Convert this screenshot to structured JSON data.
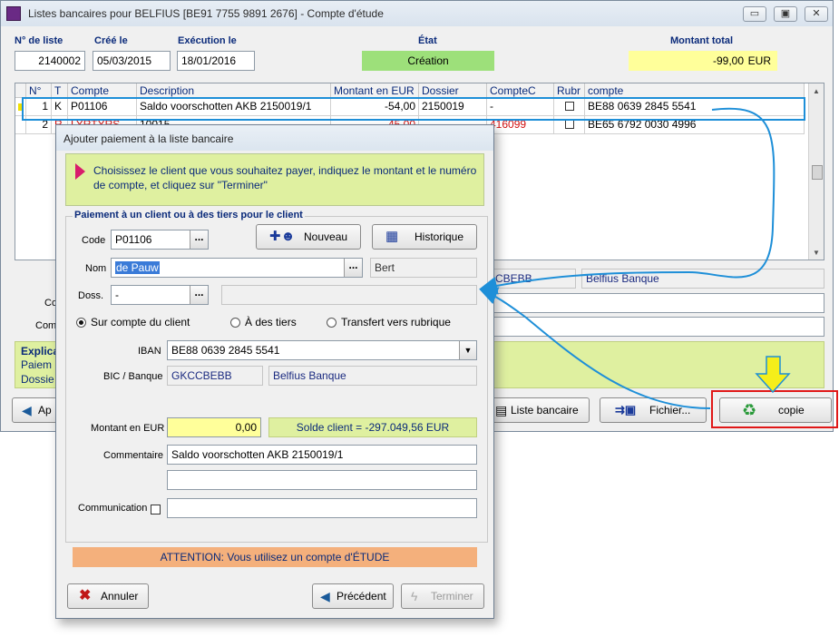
{
  "main_window": {
    "title": "Listes bancaires pour BELFIUS [BE91 7755 9891 2676] - Compte d'étude",
    "minimize": "▭",
    "restore": "▣",
    "close": "✕"
  },
  "header": {
    "num_label": "N° de liste",
    "num_value": "2140002",
    "created_label": "Créé le",
    "created_value": "05/03/2015",
    "exec_label": "Exécution le",
    "exec_value": "18/01/2016",
    "state_label": "État",
    "state_value": "Création",
    "total_label": "Montant total",
    "total_value": "-99,00",
    "total_currency": "EUR"
  },
  "grid": {
    "columns": [
      "N°",
      "T",
      "Compte",
      "Description",
      "Montant en EUR",
      "Dossier",
      "CompteC",
      "Rubr",
      "compte"
    ],
    "rows": [
      {
        "n": "1",
        "t": "K",
        "compte": "P01106",
        "description": "Saldo voorschotten AKB 2150019/1",
        "montant": "-54,00",
        "dossier": "2150019",
        "comptec": "-",
        "iban": "BE88 0639 2845 5541"
      },
      {
        "n": "2",
        "t": "R",
        "compte": "LYRTYRS",
        "description": "10015",
        "montant": "-45,00",
        "dossier": "",
        "comptec": "416099",
        "iban": "BE65 6792 0030 4996"
      }
    ]
  },
  "behind": {
    "bic": "CBEBB",
    "bank": "Belfius Banque",
    "lbl_co": "Co",
    "lbl_comm": "Comm",
    "expl1": "Explica",
    "expl2": "Paiem",
    "expl3": "Dossie"
  },
  "bottom_buttons": {
    "ap": "Ap",
    "liste": "Liste bancaire",
    "fichier": "Fichier...",
    "copie": "copie"
  },
  "dialog": {
    "title": "Ajouter paiement à la liste bancaire",
    "info": "Choisissez le client que vous souhaitez payer, indiquez le montant et le numéro de compte, et cliquez sur \"Terminer\"",
    "group_title": "Paiement à un client ou à des tiers pour le client",
    "code_label": "Code",
    "code_value": "P01106",
    "nouveau": "Nouveau",
    "historique": "Historique",
    "nom_label": "Nom",
    "nom_value": "de Pauw",
    "prenom_value": "Bert",
    "doss_label": "Doss.",
    "doss_value": "-",
    "radio_client": "Sur compte du client",
    "radio_tiers": "À des tiers",
    "radio_transfert": "Transfert vers rubrique",
    "iban_label": "IBAN",
    "iban_value": "BE88 0639 2845 5541",
    "bic_label": "BIC / Banque",
    "bic_value": "GKCCBEBB",
    "bank_value": "Belfius Banque",
    "montant_label": "Montant en EUR",
    "montant_value": "0,00",
    "solde": "Solde client = -297.049,56 EUR",
    "commentaire_label": "Commentaire",
    "commentaire_value": "Saldo voorschotten AKB 2150019/1",
    "commentaire2_value": "",
    "communication_label": "Communication",
    "communication_value": "",
    "attention": "ATTENTION: Vous utilisez un compte d'ÉTUDE",
    "annuler": "Annuler",
    "precedent": "Précédent",
    "terminer": "Terminer"
  },
  "colors": {
    "accent_blue": "#1e8fd8",
    "highlight_red": "#e01818",
    "arrow_yellow": "#f5ee1a",
    "state_green": "#9de07a",
    "total_yellow": "#ffff9a",
    "info_green": "#dff0a0",
    "attention_orange": "#f4b07c"
  }
}
